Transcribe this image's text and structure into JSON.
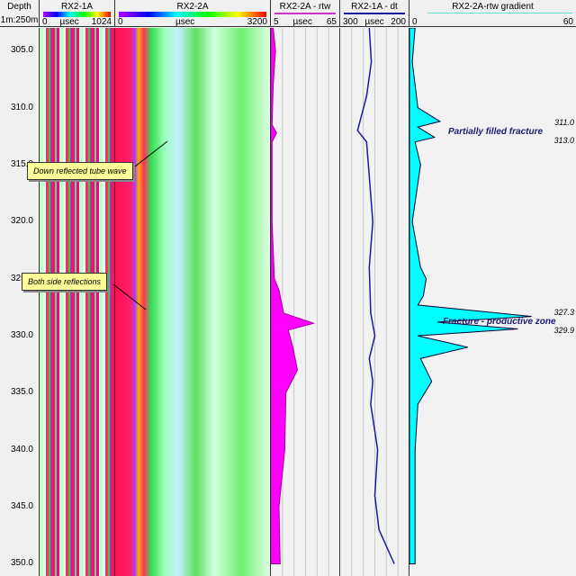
{
  "header": {
    "depth": {
      "title": "Depth",
      "scale": "1m:250m"
    },
    "tracks": [
      {
        "title": "RX2-1A",
        "min": "0",
        "unit": "µsec",
        "max": "1024"
      },
      {
        "title": "RX2-2A",
        "min": "0",
        "unit": "µsec",
        "max": "3200"
      },
      {
        "title": "RX2-2A - rtw",
        "min": "5",
        "unit": "µsec",
        "max": "65",
        "color": "#cc33cc"
      },
      {
        "title": "RX2-1A - dt",
        "min": "300",
        "unit": "µsec",
        "max": "200",
        "color": "#1a1aa0"
      },
      {
        "title": "RX2-2A-rtw gradient",
        "min": "0",
        "unit": "",
        "max": "60",
        "color": "#00e5e5"
      }
    ]
  },
  "depth_ticks": [
    "305.0",
    "310.0",
    "315.0",
    "320.0",
    "325.0",
    "330.0",
    "335.0",
    "340.0",
    "345.0",
    "350.0"
  ],
  "annotations": {
    "callout1": "Down reflected tube wave",
    "callout2": "Both side reflections",
    "note1": "Partially filled fracture",
    "note2": "Fracture - productive zone",
    "depths": [
      "311.0",
      "313.0",
      "327.3",
      "329.9"
    ]
  },
  "chart_data": {
    "type": "line",
    "depth_range": [
      303,
      350
    ],
    "series": [
      {
        "name": "RX2-2A - rtw",
        "fill": "#ff00ff",
        "range": [
          5,
          65
        ],
        "points": [
          [
            303,
            7
          ],
          [
            305,
            9
          ],
          [
            308,
            7
          ],
          [
            311.5,
            6
          ],
          [
            312.2,
            10
          ],
          [
            313,
            6
          ],
          [
            320,
            6
          ],
          [
            325,
            8
          ],
          [
            326,
            12
          ],
          [
            328,
            16
          ],
          [
            328.9,
            42
          ],
          [
            329.5,
            20
          ],
          [
            331,
            24
          ],
          [
            333,
            28
          ],
          [
            335,
            18
          ],
          [
            340,
            17
          ],
          [
            345,
            12
          ],
          [
            350,
            13
          ]
        ]
      },
      {
        "name": "RX2-1A - dt",
        "color": "#1a1aa0",
        "range": [
          300,
          200
        ],
        "points": [
          [
            303,
            258
          ],
          [
            306,
            255
          ],
          [
            309,
            262
          ],
          [
            312,
            275
          ],
          [
            313,
            262
          ],
          [
            316,
            258
          ],
          [
            320,
            253
          ],
          [
            324,
            258
          ],
          [
            328,
            256
          ],
          [
            330,
            250
          ],
          [
            332,
            258
          ],
          [
            334,
            253
          ],
          [
            336,
            256
          ],
          [
            340,
            246
          ],
          [
            344,
            250
          ],
          [
            347,
            244
          ],
          [
            350,
            222
          ]
        ]
      },
      {
        "name": "RX2-2A-rtw gradient",
        "fill": "#00ffff",
        "range": [
          0,
          60
        ],
        "points": [
          [
            303,
            2
          ],
          [
            306,
            1
          ],
          [
            310,
            3
          ],
          [
            311.2,
            11
          ],
          [
            311.7,
            3
          ],
          [
            312.6,
            9
          ],
          [
            313,
            2
          ],
          [
            315,
            4
          ],
          [
            320,
            1
          ],
          [
            324,
            4
          ],
          [
            325,
            6
          ],
          [
            326.5,
            5
          ],
          [
            327.3,
            3
          ],
          [
            328.3,
            44
          ],
          [
            328.8,
            10
          ],
          [
            329.4,
            39
          ],
          [
            330,
            3
          ],
          [
            331,
            21
          ],
          [
            332,
            4
          ],
          [
            334,
            8
          ],
          [
            336,
            3
          ],
          [
            340,
            2
          ],
          [
            345,
            2
          ],
          [
            350,
            2
          ]
        ]
      }
    ]
  }
}
